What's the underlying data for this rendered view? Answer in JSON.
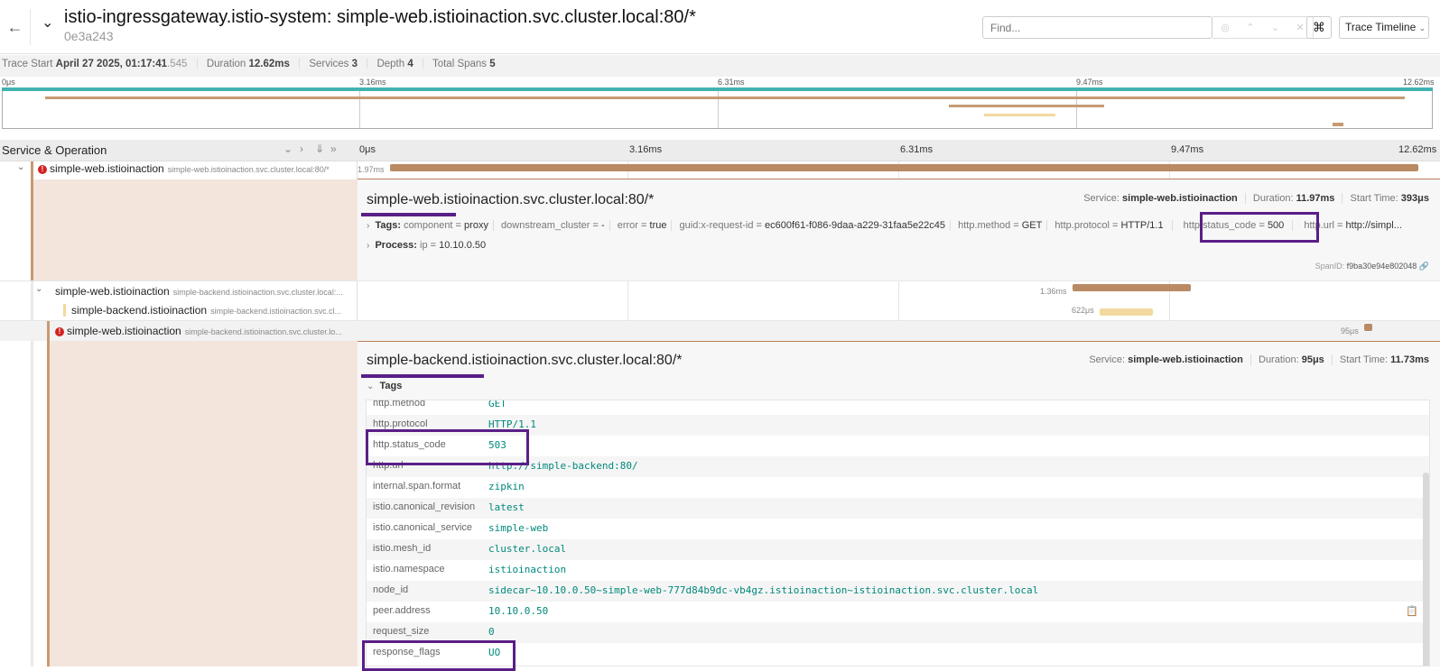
{
  "header": {
    "title": "istio-ingressgateway.istio-system: simple-web.istioinaction.svc.cluster.local:80/*",
    "trace_id": "0e3a243",
    "find_placeholder": "Find...",
    "kbd_icon": "⌘",
    "view_select": "Trace Timeline"
  },
  "stats": {
    "trace_start_label": "Trace Start",
    "trace_start_value": "April 27 2025, 01:17:41",
    "trace_start_ms": ".545",
    "duration_label": "Duration",
    "duration_value": "12.62ms",
    "services_label": "Services",
    "services_value": "3",
    "depth_label": "Depth",
    "depth_value": "4",
    "total_spans_label": "Total Spans",
    "total_spans_value": "5"
  },
  "minimap": {
    "ticks": [
      "0μs",
      "3.16ms",
      "6.31ms",
      "9.47ms",
      "12.62ms"
    ]
  },
  "timeline_header": {
    "label": "Service & Operation",
    "ticks": [
      "0μs",
      "3.16ms",
      "6.31ms",
      "9.47ms",
      "12.62ms"
    ]
  },
  "spans": [
    {
      "service": "simple-web.istioinaction",
      "operation": "simple-web.istioinaction.svc.cluster.local:80/*",
      "duration": "1.97ms"
    },
    {
      "service": "simple-web.istioinaction",
      "operation": "simple-backend.istioinaction.svc.cluster.local:...",
      "duration": "1.36ms"
    },
    {
      "service": "simple-backend.istioinaction",
      "operation": "simple-backend.istioinaction.svc.cl...",
      "duration": "622μs"
    },
    {
      "service": "simple-web.istioinaction",
      "operation": "simple-backend.istioinaction.svc.cluster.lo...",
      "duration": "95μs"
    }
  ],
  "detail1": {
    "title": "simple-web.istioinaction.svc.cluster.local:80/*",
    "service_label": "Service:",
    "service": "simple-web.istioinaction",
    "duration_label": "Duration:",
    "duration": "11.97ms",
    "start_label": "Start Time:",
    "start": "393μs",
    "tags_label": "Tags:",
    "tags": [
      {
        "k": "component",
        "v": "proxy"
      },
      {
        "k": "downstream_cluster",
        "v": "-"
      },
      {
        "k": "error",
        "v": "true"
      },
      {
        "k": "guid:x-request-id",
        "v": "ec600f61-f086-9daa-a229-31faa5e22c45"
      },
      {
        "k": "http.method",
        "v": "GET"
      },
      {
        "k": "http.protocol",
        "v": "HTTP/1.1"
      },
      {
        "k": "http.status_code",
        "v": "500"
      },
      {
        "k": "http.url",
        "v": "http://simpl..."
      }
    ],
    "process_label": "Process:",
    "process": {
      "k": "ip",
      "v": "10.10.0.50"
    },
    "span_id_label": "SpanID:",
    "span_id": "f9ba30e94e802048"
  },
  "detail2": {
    "title": "simple-backend.istioinaction.svc.cluster.local:80/*",
    "service_label": "Service:",
    "service": "simple-web.istioinaction",
    "duration_label": "Duration:",
    "duration": "95μs",
    "start_label": "Start Time:",
    "start": "11.73ms",
    "tags_label": "Tags",
    "tags": [
      {
        "k": "http.method",
        "v": "GET"
      },
      {
        "k": "http.protocol",
        "v": "HTTP/1.1"
      },
      {
        "k": "http.status_code",
        "v": "503"
      },
      {
        "k": "http.url",
        "v": "http://simple-backend:80/"
      },
      {
        "k": "internal.span.format",
        "v": "zipkin"
      },
      {
        "k": "istio.canonical_revision",
        "v": "latest"
      },
      {
        "k": "istio.canonical_service",
        "v": "simple-web"
      },
      {
        "k": "istio.mesh_id",
        "v": "cluster.local"
      },
      {
        "k": "istio.namespace",
        "v": "istioinaction"
      },
      {
        "k": "node_id",
        "v": "sidecar~10.10.0.50~simple-web-777d84b9dc-vb4gz.istioinaction~istioinaction.svc.cluster.local"
      },
      {
        "k": "peer.address",
        "v": "10.10.0.50"
      },
      {
        "k": "request_size",
        "v": "0"
      },
      {
        "k": "response_flags",
        "v": "UO"
      }
    ]
  }
}
